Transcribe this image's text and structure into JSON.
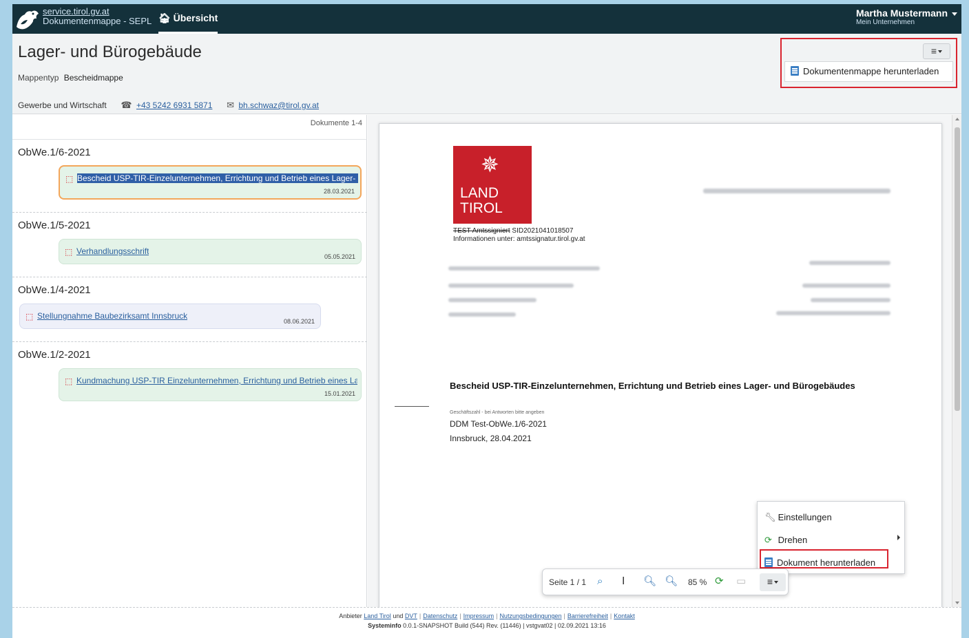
{
  "app": {
    "brand_link": "service.tirol.gv.at",
    "brand_sub": "Dokumentenmappe - SEPL",
    "nav_home": "Übersicht"
  },
  "user": {
    "name": "Martha Mustermann",
    "company": "Mein Unternehmen"
  },
  "header": {
    "title": "Lager- und Bürogebäude",
    "mappentyp_label": "Mappentyp",
    "mappentyp_value": "Bescheidmappe",
    "department": "Gewerbe und Wirtschaft",
    "phone": "+43 5242 6931 5871",
    "email": "bh.schwaz@tirol.gv.at",
    "menu_toggle": "≡",
    "menu_download": "Dokumentenmappe herunterladen"
  },
  "documents": {
    "count_label": "Dokumente 1-4",
    "groups": [
      {
        "title": "ObWe.1/6-2021",
        "doc_title": "Bescheid USP-TIR-Einzelunternehmen, Errichtung und Betrieb eines Lager- und Bürogebäudes",
        "date": "28.03.2021"
      },
      {
        "title": "ObWe.1/5-2021",
        "doc_title": "Verhandlungsschrift",
        "date": "05.05.2021"
      },
      {
        "title": "ObWe.1/4-2021",
        "doc_title": "Stellungnahme Baubezirksamt Innsbruck",
        "date": "08.06.2021"
      },
      {
        "title": "ObWe.1/2-2021",
        "doc_title": "Kundmachung USP-TIR Einzelunternehmen, Errichtung und Betrieb eines Lager- und Bürogebäudes",
        "date": "15.01.2021"
      }
    ]
  },
  "viewer": {
    "logo_line1": "LAND",
    "logo_line2": "TIROL",
    "sig_struck": "TEST Amtssigniert",
    "sig_id": "SID2021041018507",
    "sig_info": "Informationen unter: amtssignatur.tirol.gv.at",
    "subject": "Bescheid USP-TIR-Einzelunternehmen, Errichtung und Betrieb eines Lager- und Bürogebäudes",
    "gz_hint": "Geschäftszahl - bei Antworten bitte angeben",
    "gz": "DDM Test-ObWe.1/6-2021",
    "place_date": "Innsbruck, 28.04.2021"
  },
  "context_menu": {
    "settings": "Einstellungen",
    "rotate": "Drehen",
    "download": "Dokument herunterladen"
  },
  "toolbar": {
    "page": "Seite 1 / 1",
    "zoom": "85 %",
    "menu": "≡"
  },
  "footer": {
    "provider_label": "Anbieter",
    "land_tirol": "Land Tirol",
    "und": "und",
    "dvt": "DVT",
    "datenschutz": "Datenschutz",
    "impressum": "Impressum",
    "nutzungsbedingungen": "Nutzungsbedingungen",
    "barrierefreiheit": "Barrierefreiheit",
    "kontakt": "Kontakt",
    "sysinfo_label": "Systeminfo",
    "sysinfo_value": "0.0.1-SNAPSHOT Build (544) Rev. (11446) | vstgvat02 | 02.09.2021 13:16"
  },
  "colors": {
    "topbar": "#14313b",
    "accent_red": "#d9232e",
    "tirol_red": "#c8202a",
    "card_green": "#e4f3e8",
    "selection": "#2f5fa7"
  }
}
